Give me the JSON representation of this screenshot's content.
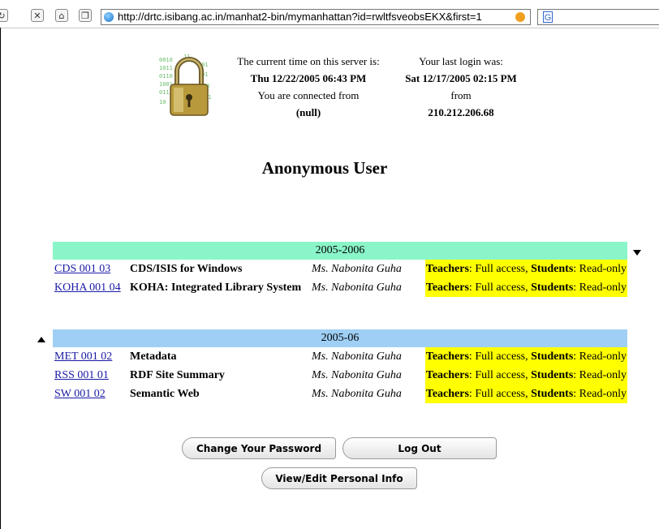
{
  "browser": {
    "url": "http://drtc.isibang.ac.in/manhat2-bin/mymanhattan?id=rwltfsveobsEKX&first=1",
    "search_glyph": "G",
    "nav_icons": [
      "reload-icon",
      "stop-icon",
      "home-icon",
      "new-window-icon"
    ]
  },
  "server_info": {
    "current_time_label": "The current time on this server is:",
    "current_time": "Thu 12/22/2005 06:43 PM",
    "connected_from_label": "You are connected from",
    "connected_from": "(null)",
    "last_login_label": "Your last login was:",
    "last_login": "Sat 12/17/2005 02:15 PM",
    "last_login_from_label": "from",
    "last_login_from": "210.212.206.68"
  },
  "user_title": "Anonymous User",
  "sections": [
    {
      "year": "2005-2006",
      "color": "#8af5c8",
      "courses": [
        {
          "code": "CDS 001 03",
          "title": "CDS/ISIS for Windows",
          "teacher": "Ms. Nabonita Guha",
          "teachers_label": "Teachers",
          "teachers_access": "Full access,",
          "students_label": "Students",
          "students_access": "Read-only"
        },
        {
          "code": "KOHA 001 04",
          "title": "KOHA: Integrated Library System",
          "teacher": "Ms. Nabonita Guha",
          "teachers_label": "Teachers",
          "teachers_access": "Full access,",
          "students_label": "Students",
          "students_access": "Read-only"
        }
      ]
    },
    {
      "year": "2005-06",
      "color": "#9fcff5",
      "courses": [
        {
          "code": "MET 001 02",
          "title": "Metadata",
          "teacher": "Ms. Nabonita Guha",
          "teachers_label": "Teachers",
          "teachers_access": "Full access,",
          "students_label": "Students",
          "students_access": "Read-only"
        },
        {
          "code": "RSS 001 01",
          "title": "RDF Site Summary",
          "teacher": "Ms. Nabonita Guha",
          "teachers_label": "Teachers",
          "teachers_access": "Full access,",
          "students_label": "Students",
          "students_access": "Read-only"
        },
        {
          "code": "SW 001 02",
          "title": "Semantic Web",
          "teacher": "Ms. Nabonita Guha",
          "teachers_label": "Teachers",
          "teachers_access": "Full access,",
          "students_label": "Students",
          "students_access": "Read-only"
        }
      ]
    }
  ],
  "buttons": {
    "change_password": "Change Your Password",
    "log_out": "Log Out",
    "view_edit": "View/Edit Personal Info"
  },
  "highlight_color": "#ffff00"
}
